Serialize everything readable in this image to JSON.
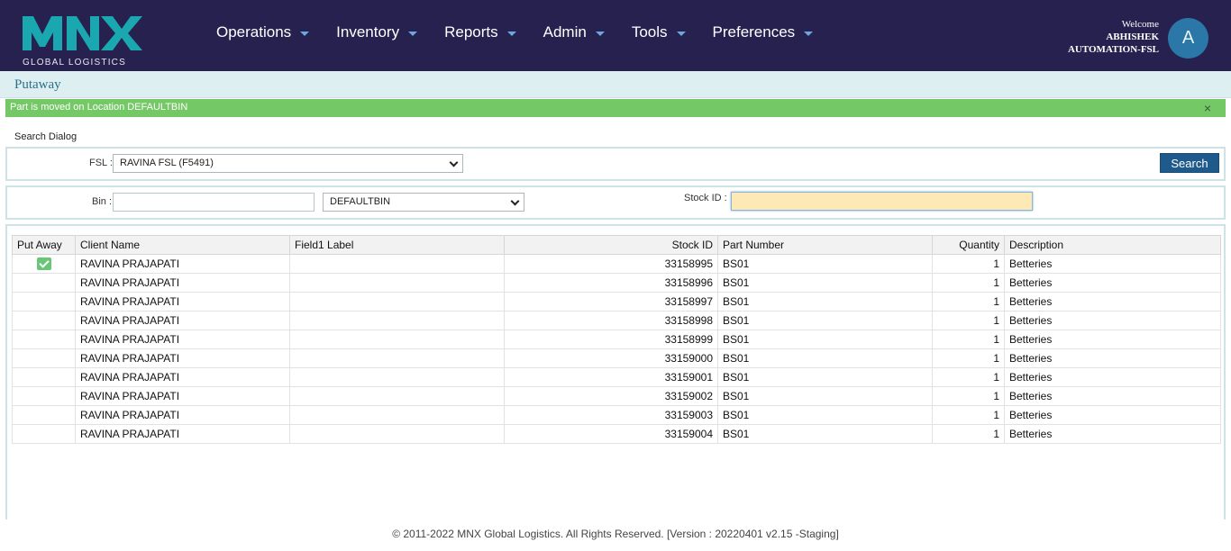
{
  "brand": {
    "logo_text": "MNX",
    "logo_sub": "GLOBAL LOGISTICS",
    "accent": "#27214f"
  },
  "nav": [
    {
      "label": "Operations"
    },
    {
      "label": "Inventory"
    },
    {
      "label": "Reports"
    },
    {
      "label": "Admin"
    },
    {
      "label": "Tools"
    },
    {
      "label": "Preferences"
    }
  ],
  "user": {
    "welcome": "Welcome",
    "first": "ABHISHEK",
    "last": "AUTOMATION-FSL",
    "avatar_letter": "A"
  },
  "breadcrumb": "Putaway",
  "alert": {
    "message": "Part is moved on Location DEFAULTBIN",
    "close": "×",
    "color": "#74c866"
  },
  "search": {
    "title": "Search Dialog",
    "fsl_label": "FSL :",
    "fsl_value": "RAVINA FSL (F5491)",
    "search_button": "Search",
    "bin_label": "Bin :",
    "bin_value": "",
    "bin_select": "DEFAULTBIN",
    "stock_label": "Stock ID :",
    "stock_value": ""
  },
  "table": {
    "headers": [
      "Put Away",
      "Client Name",
      "Field1 Label",
      "Stock ID",
      "Part Number",
      "Quantity",
      "Description"
    ],
    "rows": [
      {
        "put_away": true,
        "client": "RAVINA PRAJAPATI",
        "field1": "",
        "stock_id": "33158995",
        "part": "BS01",
        "qty": "1",
        "desc": "Betteries"
      },
      {
        "put_away": false,
        "client": "RAVINA PRAJAPATI",
        "field1": "",
        "stock_id": "33158996",
        "part": "BS01",
        "qty": "1",
        "desc": "Betteries"
      },
      {
        "put_away": false,
        "client": "RAVINA PRAJAPATI",
        "field1": "",
        "stock_id": "33158997",
        "part": "BS01",
        "qty": "1",
        "desc": "Betteries"
      },
      {
        "put_away": false,
        "client": "RAVINA PRAJAPATI",
        "field1": "",
        "stock_id": "33158998",
        "part": "BS01",
        "qty": "1",
        "desc": "Betteries"
      },
      {
        "put_away": false,
        "client": "RAVINA PRAJAPATI",
        "field1": "",
        "stock_id": "33158999",
        "part": "BS01",
        "qty": "1",
        "desc": "Betteries"
      },
      {
        "put_away": false,
        "client": "RAVINA PRAJAPATI",
        "field1": "",
        "stock_id": "33159000",
        "part": "BS01",
        "qty": "1",
        "desc": "Betteries"
      },
      {
        "put_away": false,
        "client": "RAVINA PRAJAPATI",
        "field1": "",
        "stock_id": "33159001",
        "part": "BS01",
        "qty": "1",
        "desc": "Betteries"
      },
      {
        "put_away": false,
        "client": "RAVINA PRAJAPATI",
        "field1": "",
        "stock_id": "33159002",
        "part": "BS01",
        "qty": "1",
        "desc": "Betteries"
      },
      {
        "put_away": false,
        "client": "RAVINA PRAJAPATI",
        "field1": "",
        "stock_id": "33159003",
        "part": "BS01",
        "qty": "1",
        "desc": "Betteries"
      },
      {
        "put_away": false,
        "client": "RAVINA PRAJAPATI",
        "field1": "",
        "stock_id": "33159004",
        "part": "BS01",
        "qty": "1",
        "desc": "Betteries"
      }
    ]
  },
  "footer": "© 2011-2022 MNX Global Logistics. All Rights Reserved. [Version : 20220401 v2.15 -Staging]"
}
